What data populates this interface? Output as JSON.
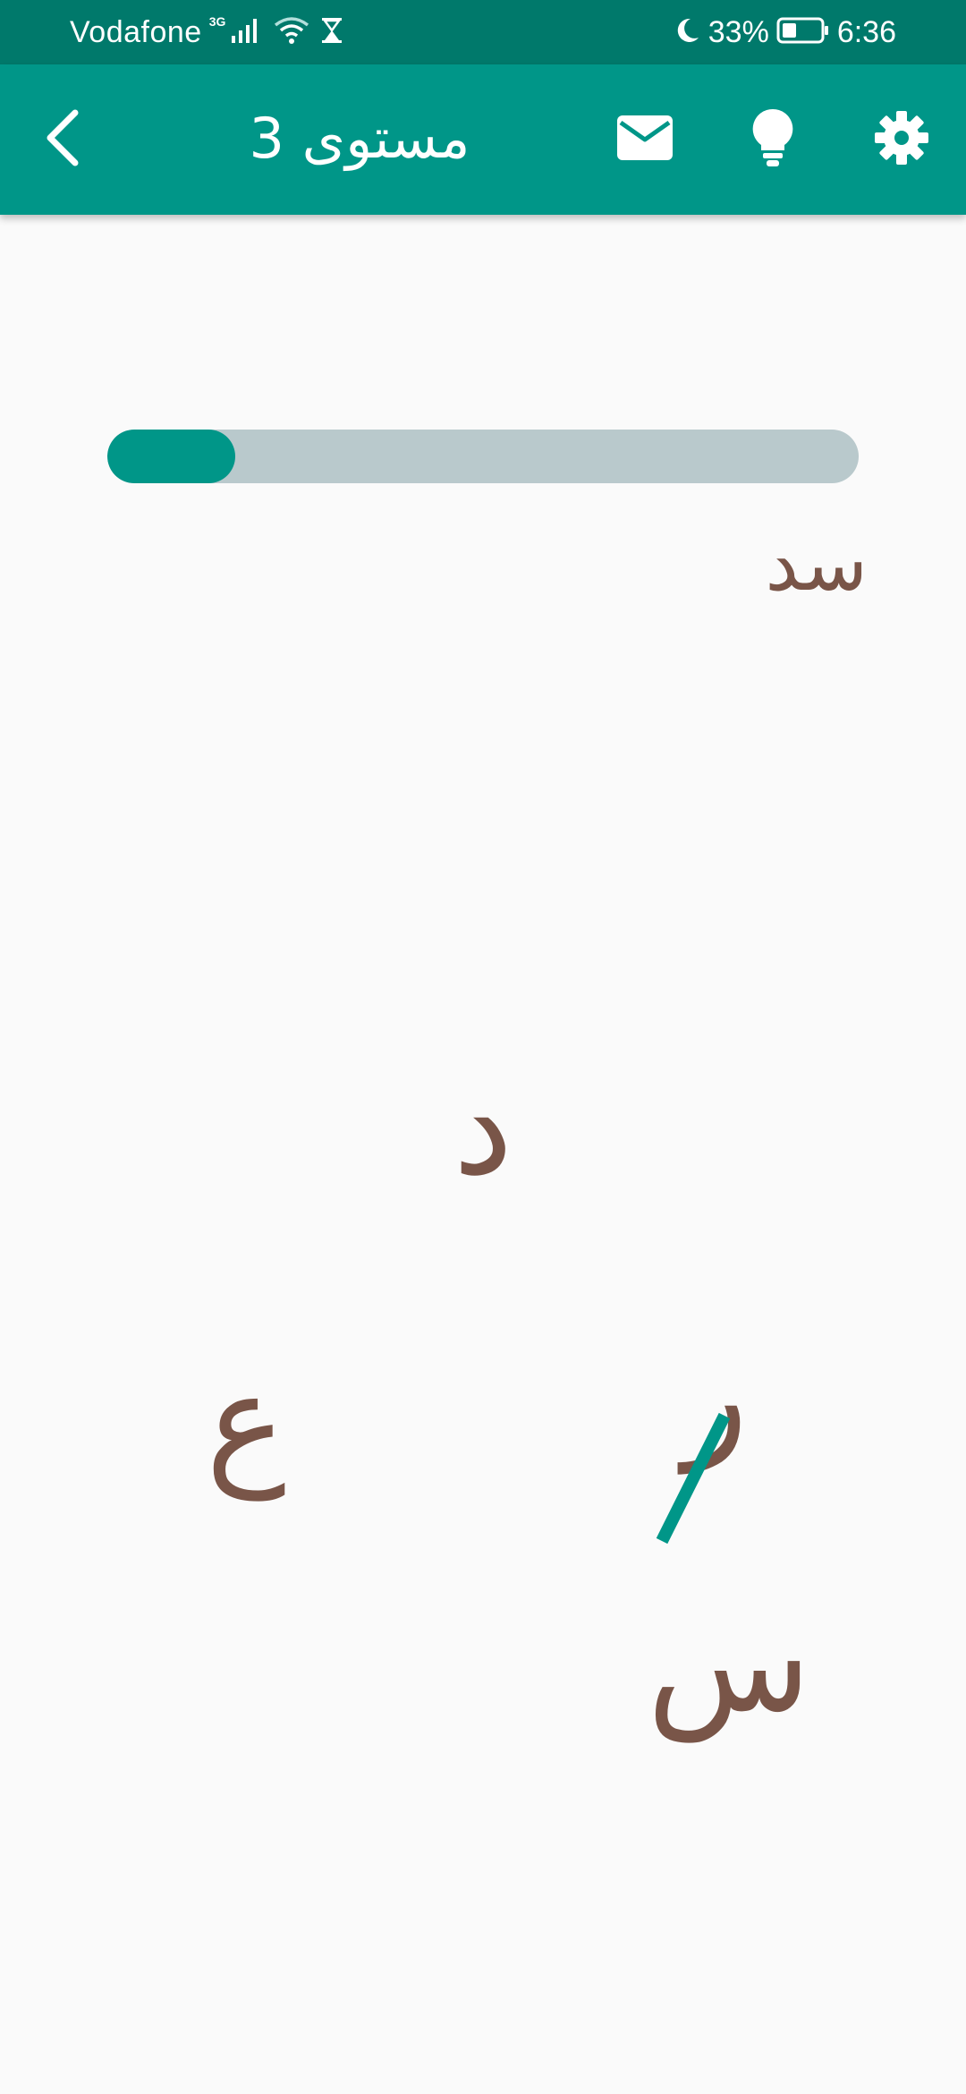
{
  "status_bar": {
    "carrier": "Vodafone",
    "network_type": "3G",
    "battery_percent": "33%",
    "time": "6:36",
    "icons": [
      "signal-icon",
      "wifi-icon",
      "hourglass-icon",
      "moon-icon",
      "battery-icon"
    ]
  },
  "app_bar": {
    "title": "مستوى 3",
    "icons": [
      "back-icon",
      "mail-icon",
      "lightbulb-icon",
      "gear-icon"
    ]
  },
  "progress": {
    "value": 0.17
  },
  "puzzle": {
    "current_word": "سد",
    "letters": {
      "top": "د",
      "left": "ع",
      "right": "ر",
      "bottom": "س"
    }
  },
  "colors": {
    "status_bar": "#00796b",
    "app_bar": "#009688",
    "accent": "#009688",
    "letter": "#795548",
    "progress_track": "#b9c9cc",
    "background": "#fafafa"
  }
}
